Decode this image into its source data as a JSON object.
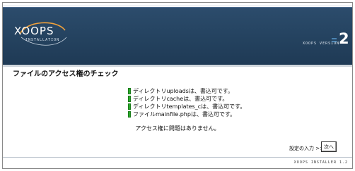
{
  "header": {
    "logo_text": "XOOPS",
    "logo_sub": "INSTALLATION",
    "version_label": "XOOPS VERSION",
    "version_number": "2"
  },
  "main": {
    "title": "ファイルのアクセス権のチェック",
    "checks": [
      {
        "text": "ディレクトリuploadsは、書込可です。"
      },
      {
        "text": "ディレクトリcacheは、書込可です。"
      },
      {
        "text": "ディレクトリtemplates_cは、書込可です。"
      },
      {
        "text": "ファイルmainfile.phpは、書込可です。"
      }
    ],
    "summary": "アクセス権に問題はありません。"
  },
  "navigation": {
    "next_label": "設定の入力 >>",
    "next_button": "次へ"
  },
  "footer": {
    "text": "XOOPS INSTALLER 1.2"
  },
  "colors": {
    "header": "#24425f",
    "ok": "#2ba92b"
  },
  "icons": {
    "check": "ok-icon",
    "logo": "xoops-logo-icon"
  }
}
